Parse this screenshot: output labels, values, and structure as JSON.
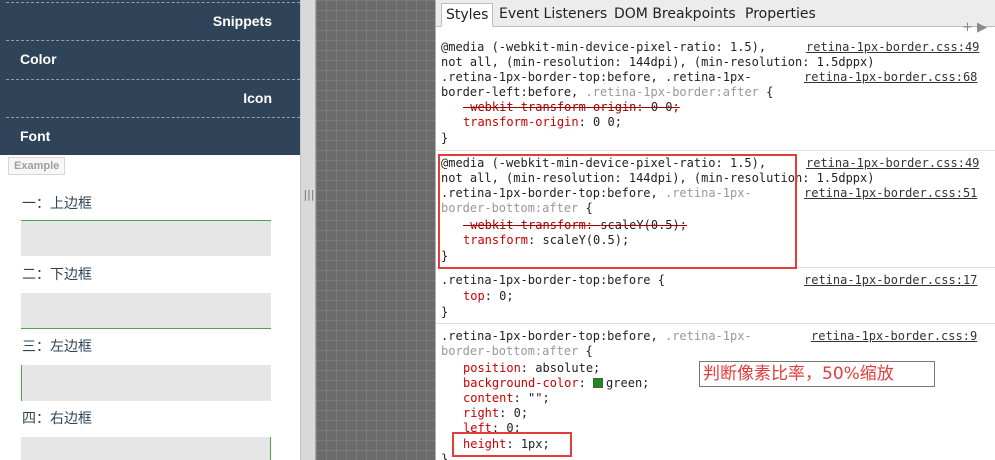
{
  "left_panel": {
    "nav": [
      {
        "label": "Snippets",
        "align": "right"
      },
      {
        "label": "Color",
        "align": "left"
      },
      {
        "label": "Icon",
        "align": "right"
      },
      {
        "label": "Font",
        "align": "left"
      }
    ],
    "example_tag": "Example",
    "demos": [
      {
        "label": "一：上边框",
        "border": "top"
      },
      {
        "label": "二：下边框",
        "border": "bottom"
      },
      {
        "label": "三：左边框",
        "border": "left"
      },
      {
        "label": "四：右边框",
        "border": "right"
      }
    ]
  },
  "splitter": {
    "handle": "|||"
  },
  "devtools": {
    "tabs": [
      "Styles",
      "Event Listeners",
      "DOM Breakpoints",
      "Properties"
    ],
    "active_tab": "Styles",
    "toolbar_icons": "+ ▶",
    "rules": [
      {
        "lines": [
          "@media (-webkit-min-device-pixel-ratio: 1.5),",
          "not all, (min-resolution: 144dpi), (min-resolution: 1.5dppx)",
          ".retina-1px-border-top:before, .retina-1px-",
          "border-left:before, ",
          ".retina-1px-border:after",
          " {"
        ],
        "src1": "retina-1px-border.css:49",
        "src2": "retina-1px-border.css:68",
        "decls": [
          {
            "prop": "-webkit-transform-origin",
            "value": "0 0",
            "struck": true
          },
          {
            "prop": "transform-origin",
            "value": "0 0",
            "struck": false
          }
        ]
      },
      {
        "lines": [
          "@media (-webkit-min-device-pixel-ratio: 1.5),",
          "not all, (min-resolution: 144dpi), (min-resolution: 1.5dppx)",
          ".retina-1px-border-top:before, ",
          ".retina-1px-",
          "border-bottom:after",
          " {"
        ],
        "src1": "retina-1px-border.css:49",
        "src2": "retina-1px-border.css:51",
        "decls": [
          {
            "prop": "-webkit-transform",
            "value": "scaleY(0.5)",
            "struck": true
          },
          {
            "prop": "transform",
            "value": "scaleY(0.5)",
            "struck": false
          }
        ]
      },
      {
        "selector": ".retina-1px-border-top:before {",
        "src1": "retina-1px-border.css:17",
        "decls": [
          {
            "prop": "top",
            "value": "0",
            "struck": false
          }
        ]
      },
      {
        "lines": [
          ".retina-1px-border-top:before, ",
          ".retina-1px-",
          "border-bottom:after",
          " {"
        ],
        "src1": "retina-1px-border.css:9",
        "decls": [
          {
            "prop": "position",
            "value": "absolute",
            "struck": false
          },
          {
            "prop": "background-color",
            "value": "green",
            "struck": false
          },
          {
            "prop": "content",
            "value": "\"\"",
            "struck": false
          },
          {
            "prop": "right",
            "value": "0",
            "struck": false
          },
          {
            "prop": "left",
            "value": "0",
            "struck": false
          },
          {
            "prop": "height",
            "value": "1px",
            "struck": false
          }
        ]
      }
    ],
    "annotation": "判断像素比率，50%缩放",
    "colors": {
      "swatch": "#1a8a1a",
      "highlight": "#e23c3c"
    }
  }
}
